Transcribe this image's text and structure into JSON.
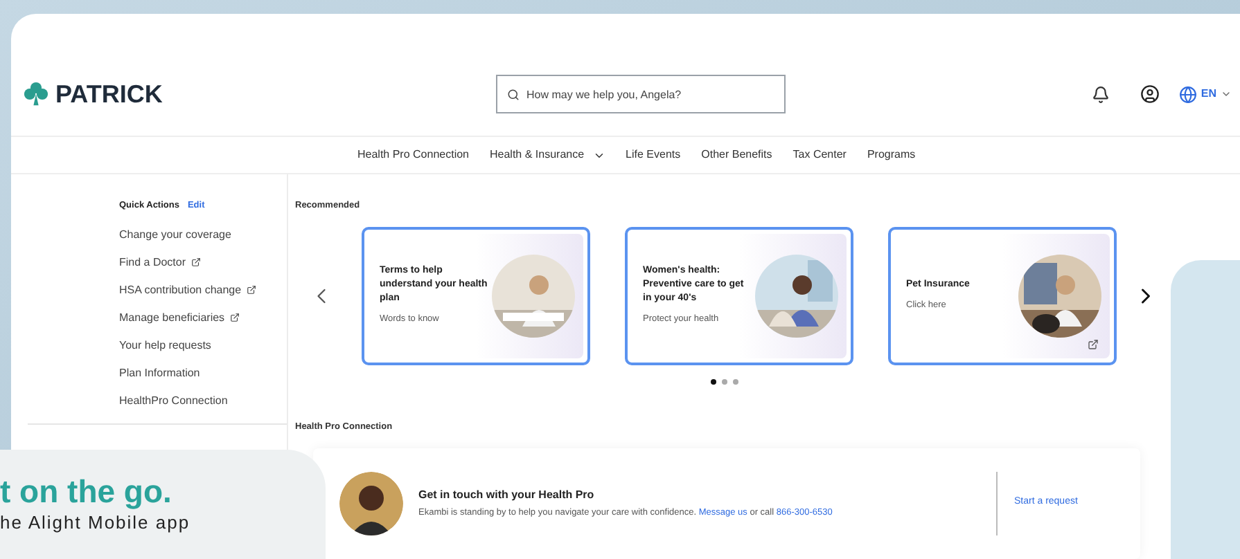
{
  "header": {
    "logo": "PATRICK",
    "search": {
      "placeholder": "How may we help you, Angela?"
    },
    "language": "EN"
  },
  "nav": [
    {
      "label": "Health Pro Connection",
      "dropdown": false
    },
    {
      "label": "Health & Insurance",
      "dropdown": true
    },
    {
      "label": "Life Events",
      "dropdown": false
    },
    {
      "label": "Other Benefits",
      "dropdown": false
    },
    {
      "label": "Tax Center",
      "dropdown": false
    },
    {
      "label": "Programs",
      "dropdown": false
    }
  ],
  "quick_actions": {
    "title": "Quick Actions",
    "edit": "Edit",
    "items": [
      {
        "label": "Change your coverage",
        "external": false
      },
      {
        "label": "Find a Doctor",
        "external": true
      },
      {
        "label": "HSA contribution change",
        "external": true
      },
      {
        "label": "Manage beneficiaries",
        "external": true
      },
      {
        "label": "Your help requests",
        "external": false
      },
      {
        "label": "Plan Information",
        "external": false
      },
      {
        "label": "HealthPro Connection",
        "external": false
      }
    ]
  },
  "recommended": {
    "title": "Recommended",
    "cards": [
      {
        "title": "Terms to help understand your health plan",
        "subtitle": "Words to know",
        "external": false
      },
      {
        "title": "Women's health: Preventive care to get in your 40's",
        "subtitle": "Protect your health",
        "external": false
      },
      {
        "title": "Pet Insurance",
        "subtitle": "Click here",
        "external": true
      }
    ],
    "dots": [
      {
        "selected": true
      },
      {
        "selected": false
      },
      {
        "selected": false
      }
    ]
  },
  "health_pro": {
    "title": "Health Pro Connection",
    "heading": "Get in touch with your Health Pro",
    "text": "Ekambi is standing by to help you navigate your care with confidence.",
    "link": "Message us",
    "middle": "or call",
    "phone": "866-300-6530",
    "action": "Start a request"
  },
  "promo": {
    "headline": "t on the go.",
    "subline": "he Alight Mobile app"
  }
}
